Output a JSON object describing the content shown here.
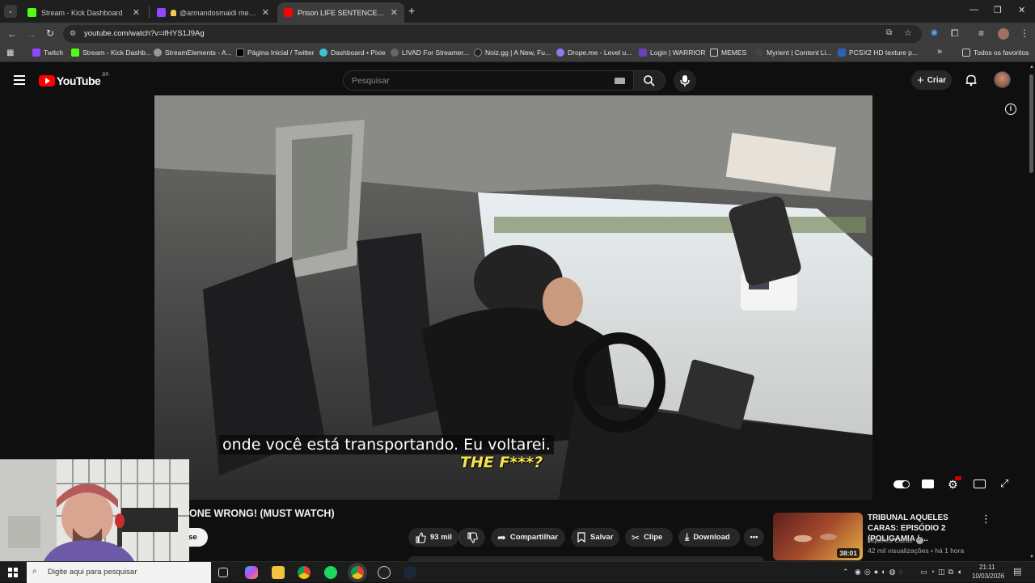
{
  "browser": {
    "tabs": [
      {
        "label": "Stream - Kick Dashboard",
        "active": false
      },
      {
        "label": "@armandosmaidi mentione",
        "active": false
      },
      {
        "label": "Prison LIFE SENTENCE Prank Gl",
        "active": true
      }
    ],
    "url": "youtube.com/watch?v=ifHYS1J9Ag",
    "bookmarks": [
      "Twitch",
      "Stream - Kick Dashb...",
      "StreamElements - A...",
      "Página Inicial / Twitter",
      "Dashboard • Pixie",
      "LIVAD For Streamer...",
      "Noiz.gg | A New, Fu...",
      "Drope.me - Level u...",
      "Login | WARRIOR",
      "MEMES",
      "Myrient | Content Li...",
      "PCSX2 HD texture p..."
    ],
    "bookmarks_overflow": "»",
    "all_bookmarks": "Todos os favoritos"
  },
  "youtube": {
    "logo_text": "YouTube",
    "logo_region": "BR",
    "search_placeholder": "Pesquisar",
    "create_label": "Criar"
  },
  "video": {
    "subtitle": "onde você está transportando.  Eu voltarei.",
    "overlay_caption": "THE F***?",
    "title": "ONE WRONG! (MUST WATCH)",
    "subscribe_partial": "se",
    "likes": "93 mil",
    "share_label": "Compartilhar",
    "save_label": "Salvar",
    "clip_label": "Clipe",
    "download_label": "Download"
  },
  "sidebar": {
    "item": {
      "title": "TRIBUNAL AQUELES CARAS: EPISÓDIO 2 (POLIGAMIA / ...",
      "channel": "Aqueles Caras",
      "meta": "42 mil visualizações • há 1 hora",
      "duration": "38:01"
    }
  },
  "taskbar": {
    "search_placeholder": "Digite aqui para pesquisar",
    "time": "21:11",
    "date": "10/03/2026"
  },
  "colors": {
    "accent_red": "#ff0000",
    "background": "#0f0f0f",
    "caption_yellow": "#f6e44a"
  }
}
